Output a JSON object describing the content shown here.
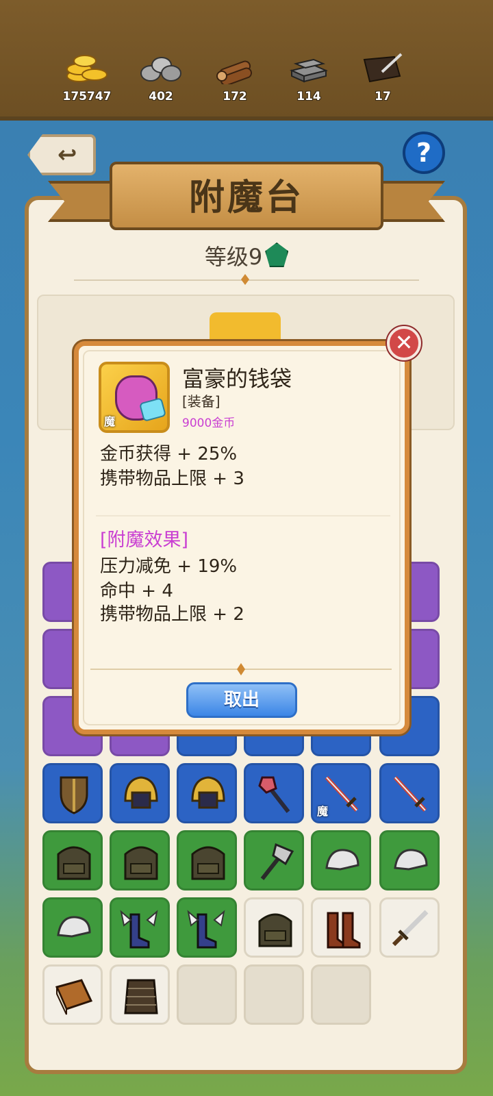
{
  "resources": [
    {
      "icon": "gold-coins-icon",
      "value": "175747"
    },
    {
      "icon": "stone-icon",
      "value": "402"
    },
    {
      "icon": "wood-logs-icon",
      "value": "172"
    },
    {
      "icon": "iron-ingot-icon",
      "value": "114"
    },
    {
      "icon": "leather-icon",
      "value": "17"
    }
  ],
  "header": {
    "title": "附魔台",
    "back_icon": "undo-arrow-icon",
    "help_label": "?"
  },
  "level": {
    "label": "等级9"
  },
  "dialog": {
    "item_name": "富豪的钱袋",
    "item_type": "[装备]",
    "item_price": "9000金币",
    "item_tag": "魔",
    "base_stats": [
      "金币获得 + 25%",
      "携带物品上限 + 3"
    ],
    "enchant_title": "[附魔效果]",
    "enchant_stats": [
      "压力减免 + 19%",
      "命中 + 4",
      "携带物品上限 + 2"
    ],
    "take_button": "取出",
    "close_label": "✕"
  },
  "inventory_tags": {
    "sword_tag": "魔"
  },
  "colors": {
    "accent_purple": "#c93fd2",
    "button_blue": "#3c86e6",
    "frame_brown": "#a77c3f"
  }
}
